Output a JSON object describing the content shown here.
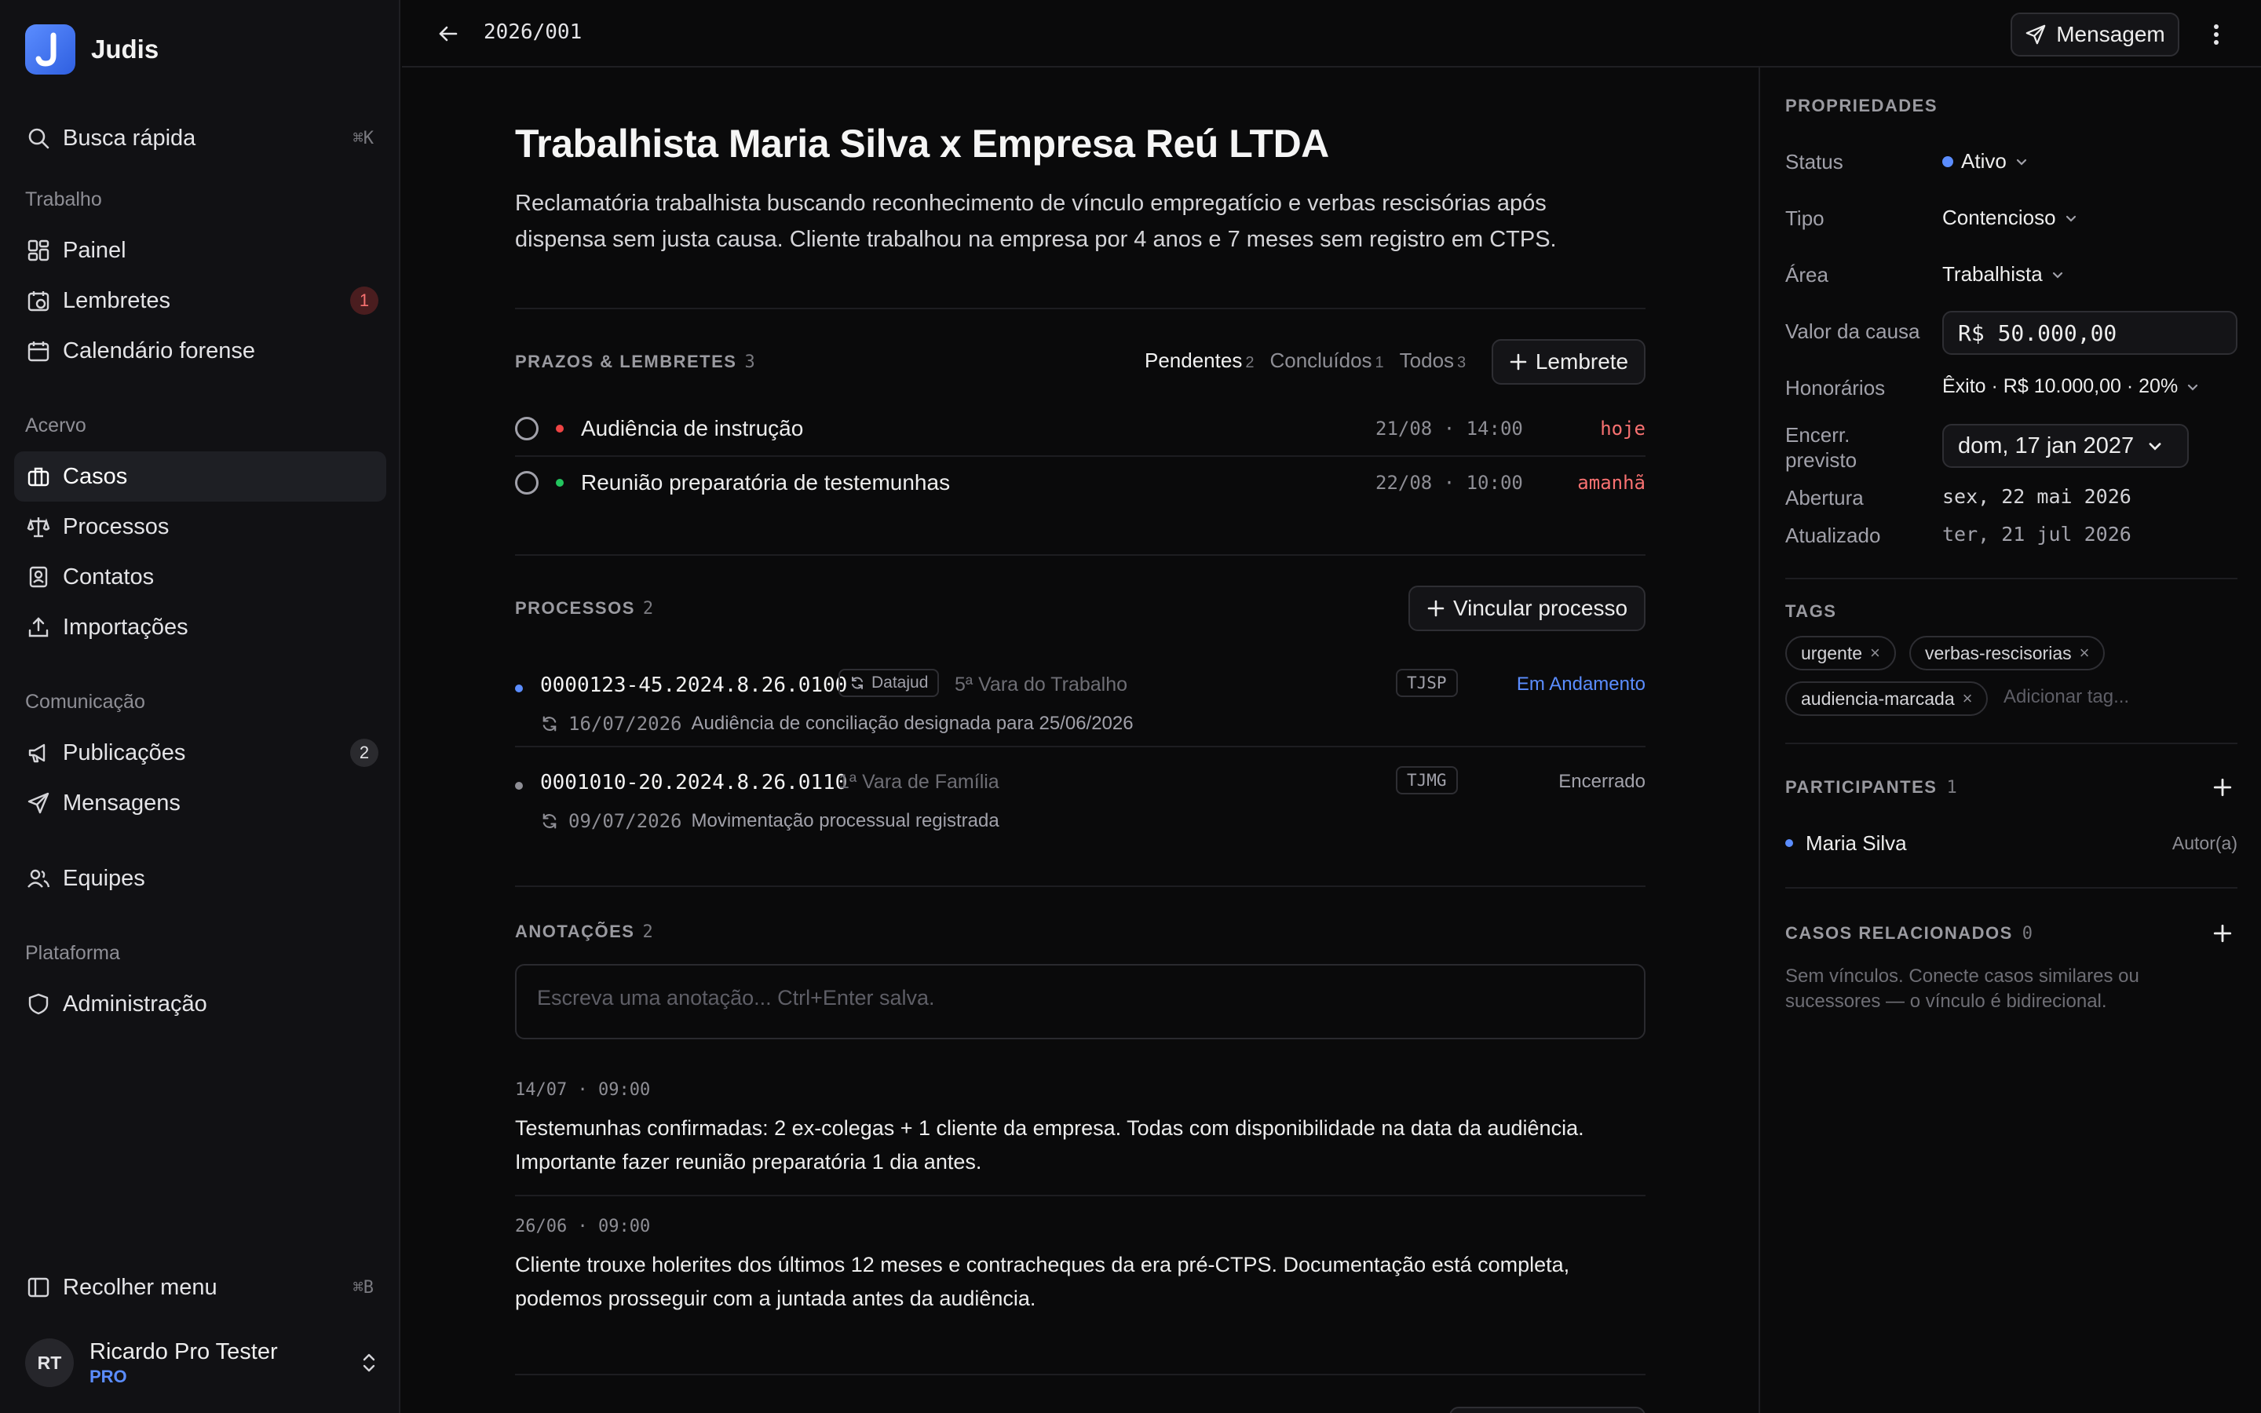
{
  "app": {
    "name": "Judis",
    "logo_letter": "J"
  },
  "sidebar": {
    "search": {
      "label": "Busca rápida",
      "shortcut": "⌘K"
    },
    "sections": [
      {
        "title": "Trabalho"
      },
      {
        "title": "Acervo"
      },
      {
        "title": "Comunicação"
      },
      {
        "title": "Plataforma"
      }
    ],
    "items": [
      {
        "label": "Painel",
        "icon": "dashboard-icon"
      },
      {
        "label": "Lembretes",
        "icon": "alarm-icon",
        "badge": "1"
      },
      {
        "label": "Calendário forense",
        "icon": "calendar-icon"
      },
      {
        "label": "Casos",
        "icon": "briefcase-icon",
        "active": true
      },
      {
        "label": "Processos",
        "icon": "scale-icon"
      },
      {
        "label": "Contatos",
        "icon": "contact-icon"
      },
      {
        "label": "Importações",
        "icon": "upload-icon"
      },
      {
        "label": "Publicações",
        "icon": "megaphone-icon",
        "badge": "2"
      },
      {
        "label": "Mensagens",
        "icon": "send-icon"
      },
      {
        "label": "Equipes",
        "icon": "users-icon"
      },
      {
        "label": "Administração",
        "icon": "shield-icon"
      }
    ],
    "collapse": {
      "label": "Recolher menu",
      "shortcut": "⌘B"
    },
    "user": {
      "initials": "RT",
      "name": "Ricardo Pro Tester",
      "plan": "PRO"
    }
  },
  "topbar": {
    "case_code": "2026/001",
    "message_label": "Mensagem"
  },
  "case": {
    "title": "Trabalhista Maria Silva x Empresa Reú LTDA",
    "description": "Reclamatória trabalhista buscando reconhecimento de vínculo empregatício e verbas rescisórias após dispensa sem justa causa. Cliente trabalhou na empresa por 4 anos e 7 meses sem registro em CTPS."
  },
  "reminders": {
    "label": "PRAZOS & LEMBRETES",
    "count": "3",
    "filters": [
      {
        "label": "Pendentes",
        "count": "2",
        "selected": true
      },
      {
        "label": "Concluídos",
        "count": "1"
      },
      {
        "label": "Todos",
        "count": "3"
      }
    ],
    "add_label": "Lembrete",
    "items": [
      {
        "title": "Audiência de instrução",
        "time": "21/08 · 14:00",
        "relative": "hoje",
        "dot_color": "#ef4444"
      },
      {
        "title": "Reunião preparatória de testemunhas",
        "time": "22/08 · 10:00",
        "relative": "amanhã",
        "dot_color": "#22c55e"
      }
    ]
  },
  "processes": {
    "label": "PROCESSOS",
    "count": "2",
    "link_label": "Vincular processo",
    "items": [
      {
        "number": "0000123-45.2024.8.26.0100",
        "source": "Datajud",
        "court": "5ª Vara do Trabalho",
        "tribunal": "TJSP",
        "status": "Em Andamento",
        "status_color": "#5b8dff",
        "dot_color": "#5b8dff",
        "last_date": "16/07/2026",
        "last_text": "Audiência de conciliação designada para 25/06/2026"
      },
      {
        "number": "0001010-20.2024.8.26.0110",
        "court": "1ª Vara de Família",
        "tribunal": "TJMG",
        "status": "Encerrado",
        "status_color": "#a1a1aa",
        "dot_color": "#8e8e95",
        "last_date": "09/07/2026",
        "last_text": "Movimentação processual registrada"
      }
    ]
  },
  "notes": {
    "label": "ANOTAÇÕES",
    "count": "2",
    "placeholder": "Escreva uma anotação... Ctrl+Enter salva.",
    "items": [
      {
        "time": "14/07 · 09:00",
        "text": "Testemunhas confirmadas: 2 ex-colegas + 1 cliente da empresa. Todas com disponibilidade na data da audiência. Importante fazer reunião preparatória 1 dia antes."
      },
      {
        "time": "26/06 · 09:00",
        "text": "Cliente trouxe holerites dos últimos 12 meses e contracheques da era pré-CTPS. Documentação está completa, podemos prosseguir com a juntada antes da audiência."
      }
    ]
  },
  "properties": {
    "label": "PROPRIEDADES",
    "status": {
      "label": "Status",
      "value": "Ativo",
      "color": "#5b8dff"
    },
    "tipo": {
      "label": "Tipo",
      "value": "Contencioso"
    },
    "area": {
      "label": "Área",
      "value": "Trabalhista"
    },
    "valor": {
      "label": "Valor da causa",
      "value": "R$ 50.000,00"
    },
    "honorarios": {
      "label": "Honorários",
      "value": "Êxito · R$ 10.000,00 · 20%"
    },
    "encerramento": {
      "label": "Encerr. previsto",
      "value": "dom, 17 jan 2027"
    },
    "abertura": {
      "label": "Abertura",
      "value": "sex, 22 mai 2026"
    },
    "atualizado": {
      "label": "Atualizado",
      "value": "ter, 21 jul 2026"
    }
  },
  "tags": {
    "label": "TAGS",
    "items": [
      "urgente",
      "verbas-rescisorias",
      "audiencia-marcada"
    ],
    "placeholder": "Adicionar tag..."
  },
  "participants": {
    "label": "PARTICIPANTES",
    "count": "1",
    "items": [
      {
        "name": "Maria Silva",
        "role": "Autor(a)",
        "dot_color": "#5b8dff"
      }
    ]
  },
  "related": {
    "label": "CASOS RELACIONADOS",
    "count": "0",
    "empty_text": "Sem vínculos. Conecte casos similares ou sucessores — o vínculo é bidirecional."
  }
}
